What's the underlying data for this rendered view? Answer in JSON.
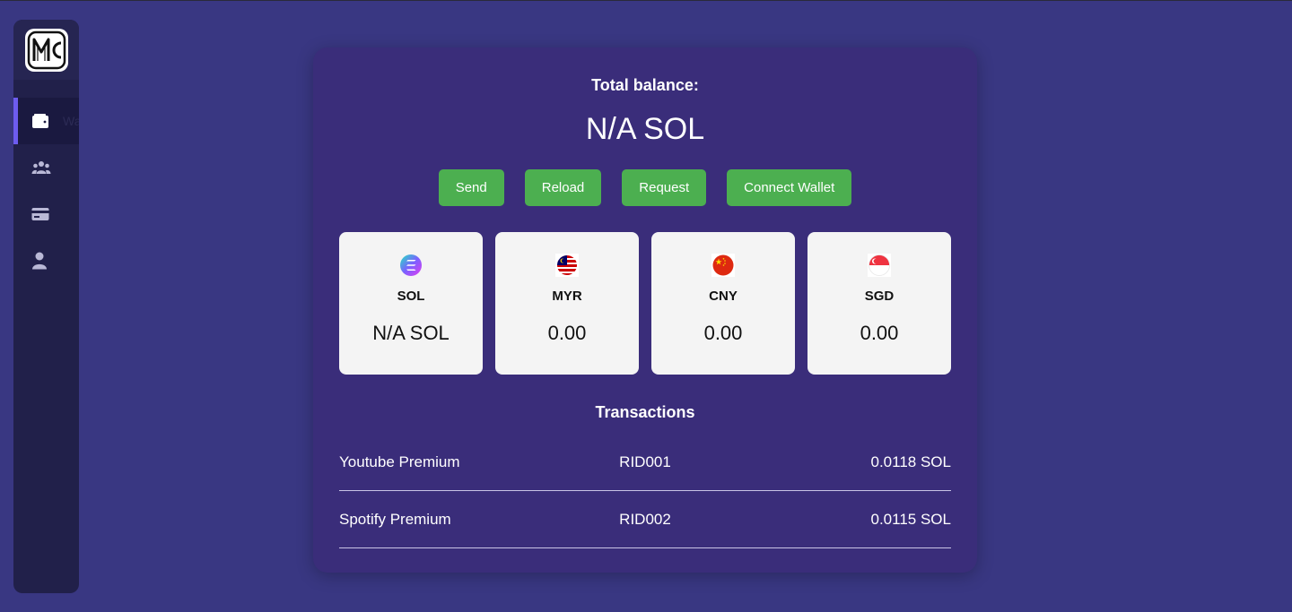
{
  "sidebar": {
    "logo_text": "MC",
    "items": [
      {
        "icon": "wallet-icon",
        "label": "Wallet",
        "active": true
      },
      {
        "icon": "users-icon",
        "label": ""
      },
      {
        "icon": "credit-card-icon",
        "label": ""
      },
      {
        "icon": "user-icon",
        "label": ""
      }
    ]
  },
  "wallet": {
    "title": "Total balance:",
    "balance": "N/A SOL",
    "actions": [
      "Send",
      "Reload",
      "Request",
      "Connect Wallet"
    ]
  },
  "currencies": [
    {
      "code": "SOL",
      "amount": "N/A SOL",
      "icon": "solana-icon"
    },
    {
      "code": "MYR",
      "amount": "0.00",
      "icon": "malaysia-flag-icon"
    },
    {
      "code": "CNY",
      "amount": "0.00",
      "icon": "china-flag-icon"
    },
    {
      "code": "SGD",
      "amount": "0.00",
      "icon": "singapore-flag-icon"
    }
  ],
  "transactions": {
    "title": "Transactions",
    "rows": [
      {
        "name": "Youtube Premium",
        "id": "RID001",
        "amount": "0.0118 SOL"
      },
      {
        "name": "Spotify Premium",
        "id": "RID002",
        "amount": "0.0115 SOL"
      }
    ]
  },
  "colors": {
    "accent": "#4caf50",
    "background": "#393782",
    "card": "#3a2d7a",
    "sidebar": "#21204a",
    "active_indicator": "#6d5cf0"
  }
}
